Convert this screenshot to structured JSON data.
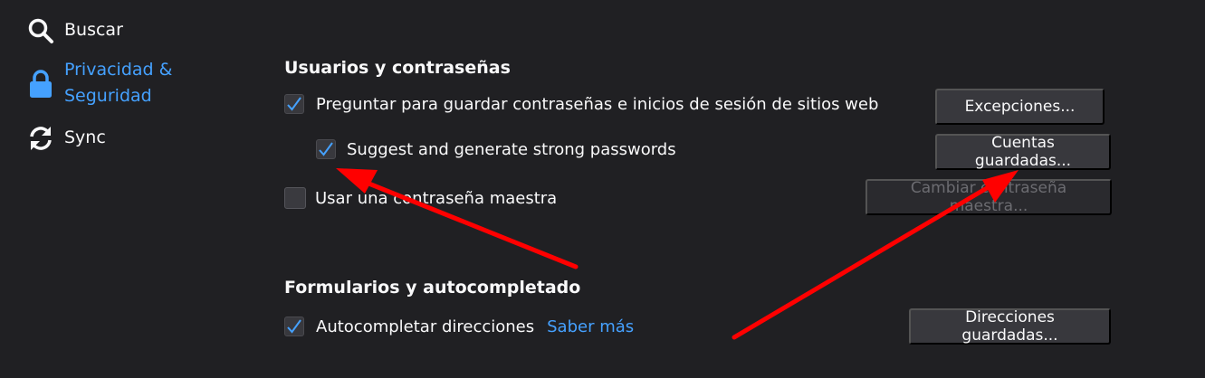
{
  "sidebar": {
    "items": [
      {
        "label": "Buscar",
        "icon": "search-icon"
      },
      {
        "label": "Privacidad &\nSeguridad",
        "icon": "lock-icon",
        "active": true
      },
      {
        "label": "Sync",
        "icon": "sync-icon"
      }
    ]
  },
  "logins": {
    "title": "Usuarios y contraseñas",
    "ask_to_save": {
      "label": "Preguntar para guardar contraseñas e inicios de sesión de sitios web",
      "checked": true
    },
    "suggest_strong": {
      "label": "Suggest and generate strong passwords",
      "checked": true
    },
    "master_password": {
      "label": "Usar una contraseña maestra",
      "checked": false
    },
    "exceptions_button": "Excepciones...",
    "saved_logins_button": "Cuentas guardadas...",
    "change_master_button": "Cambiar contraseña maestra..."
  },
  "forms": {
    "title": "Formularios y autocompletado",
    "autofill_addresses": {
      "label": "Autocompletar direcciones",
      "checked": true
    },
    "learn_more_link": "Saber más",
    "saved_addresses_button": "Direcciones guardadas..."
  },
  "colors": {
    "background": "#202023",
    "accent": "#45a1ff",
    "annotation_arrow": "#ff0000"
  }
}
